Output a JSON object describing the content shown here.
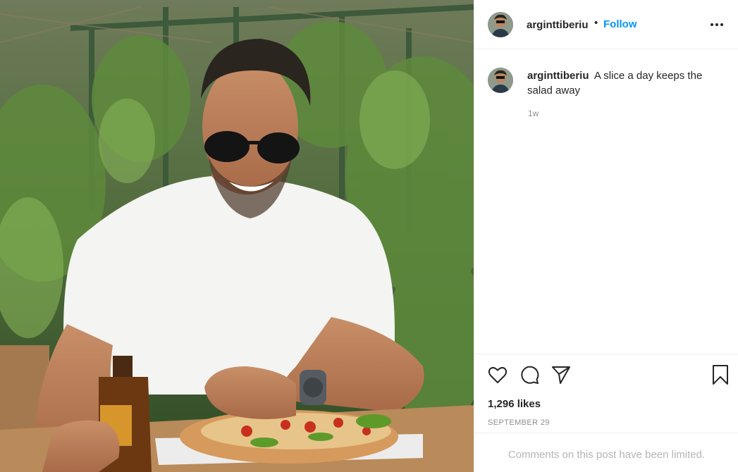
{
  "post": {
    "username": "arginttiberiu",
    "follow_label": "Follow",
    "caption": "A slice a day keeps the salad away",
    "time_ago": "1w",
    "likes": "1,296 likes",
    "date": "SEPTEMBER 29",
    "comments_notice": "Comments on this post have been limited."
  },
  "icons": {
    "more": "more-options-icon",
    "like": "heart-icon",
    "comment": "comment-bubble-icon",
    "share": "paper-plane-icon",
    "save": "bookmark-icon"
  },
  "colors": {
    "link_blue": "#0095f6",
    "text": "#262626",
    "muted": "#8e8e8e",
    "divider": "#efefef"
  }
}
